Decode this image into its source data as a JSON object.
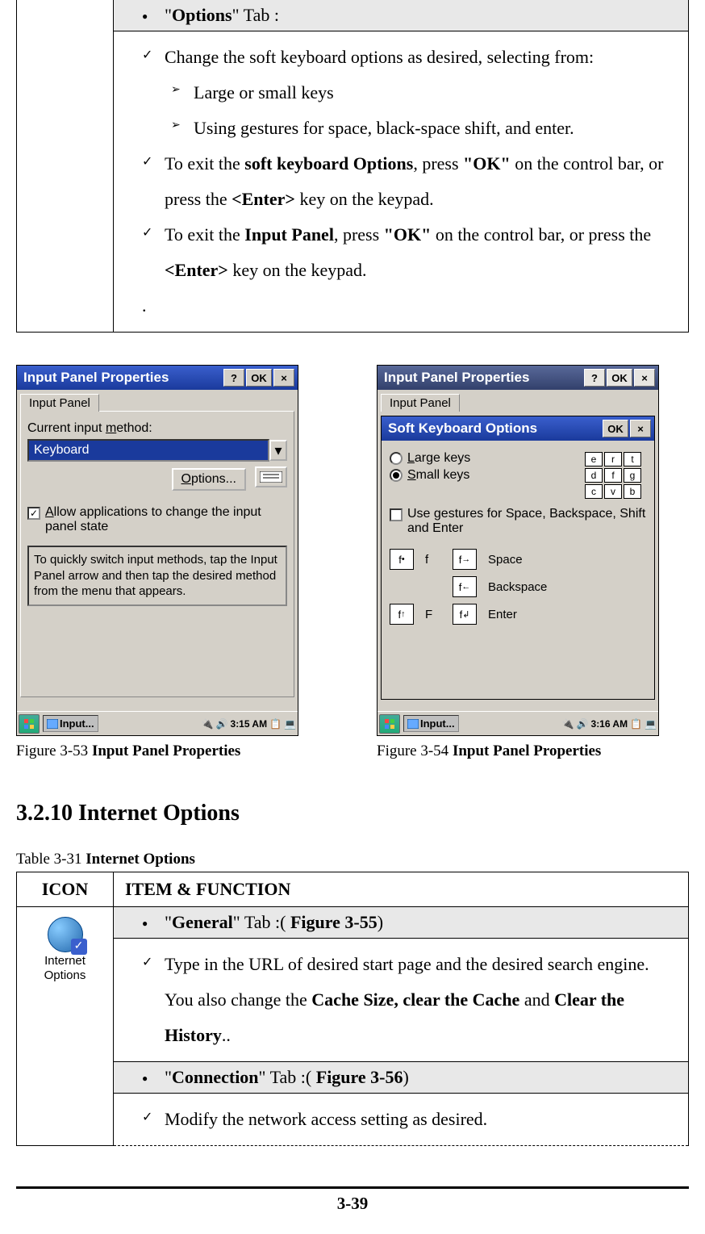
{
  "top_table": {
    "header": {
      "prefix": "\"",
      "bold": "Options",
      "suffix": "\" Tab :"
    },
    "items": [
      {
        "type": "check",
        "text": "Change the soft keyboard options as desired, selecting from:"
      },
      {
        "type": "arrow",
        "text": "Large or small keys"
      },
      {
        "type": "arrow",
        "text": "Using gestures for space, black-space shift, and enter."
      },
      {
        "type": "check",
        "parts": [
          {
            "t": "To exit the "
          },
          {
            "b": "soft keyboard Options"
          },
          {
            "t": ", press "
          },
          {
            "b": "\"OK\""
          },
          {
            "t": " on the control bar, or press the "
          },
          {
            "b": "<Enter>"
          },
          {
            "t": " key on the keypad."
          }
        ]
      },
      {
        "type": "check",
        "parts": [
          {
            "t": "To exit the "
          },
          {
            "b": "Input Panel"
          },
          {
            "t": ", press "
          },
          {
            "b": "\"OK\""
          },
          {
            "t": " on the control bar, or press the "
          },
          {
            "b": "<Enter>"
          },
          {
            "t": " key on the keypad."
          }
        ]
      },
      {
        "type": "period",
        "text": "."
      }
    ]
  },
  "fig1": {
    "caption_prefix": "Figure 3-53 ",
    "caption_bold": "Input Panel Properties",
    "window_title": "Input Panel Properties",
    "help": "?",
    "ok": "OK",
    "close": "×",
    "tab": "Input Panel",
    "label_method": "Current input method:",
    "method_value": "Keyboard",
    "options_btn": "Options...",
    "allow_check": "Allow applications to change the input panel state",
    "allow_checked": "✓",
    "help_text": "To quickly switch input methods, tap the Input Panel arrow and then tap the desired method from the menu that appears.",
    "taskbar_task": "Input...",
    "taskbar_time": "3:15 AM"
  },
  "fig2": {
    "caption_prefix": "Figure 3-54 ",
    "caption_bold": "Input Panel Properties",
    "bg_title": "Input Panel Properties",
    "bg_tab": "Input Panel",
    "window_title": "Soft Keyboard Options",
    "ok": "OK",
    "close": "×",
    "radio_large": "Large keys",
    "radio_small": "Small keys",
    "keys": [
      "e",
      "r",
      "t",
      "d",
      "f",
      "g",
      "c",
      "v",
      "b"
    ],
    "gestures_check": "Use gestures for Space, Backspace, Shift and Enter",
    "g_f": "f",
    "g_F": "F",
    "g_space": "Space",
    "g_back": "Backspace",
    "g_enter": "Enter",
    "taskbar_task": "Input...",
    "taskbar_time": "3:16 AM"
  },
  "section_title": "3.2.10 Internet Options",
  "table2_caption_prefix": "Table 3-31 ",
  "table2_caption_bold": "Internet Options",
  "table2": {
    "th_icon": "ICON",
    "th_item": "ITEM & FUNCTION",
    "icon_label": "Internet Options",
    "row1_header": {
      "prefix": "\"",
      "bold": "General",
      "mid": "\" Tab :( ",
      "bold2": "Figure 3-55",
      "suffix": ")"
    },
    "row1_body": {
      "parts": [
        {
          "t": "Type in the URL of desired start page and the desired search engine. You also change the "
        },
        {
          "b": "Cache Size, clear the Cache"
        },
        {
          "t": " and "
        },
        {
          "b": "Clear the History"
        },
        {
          "t": ".."
        }
      ]
    },
    "row2_header": {
      "prefix": "\"",
      "bold": "Connection",
      "mid": "\" Tab :( ",
      "bold2": "Figure 3-56",
      "suffix": ")"
    },
    "row2_body": {
      "text": "Modify the network access setting as desired."
    }
  },
  "page_number": "3-39"
}
